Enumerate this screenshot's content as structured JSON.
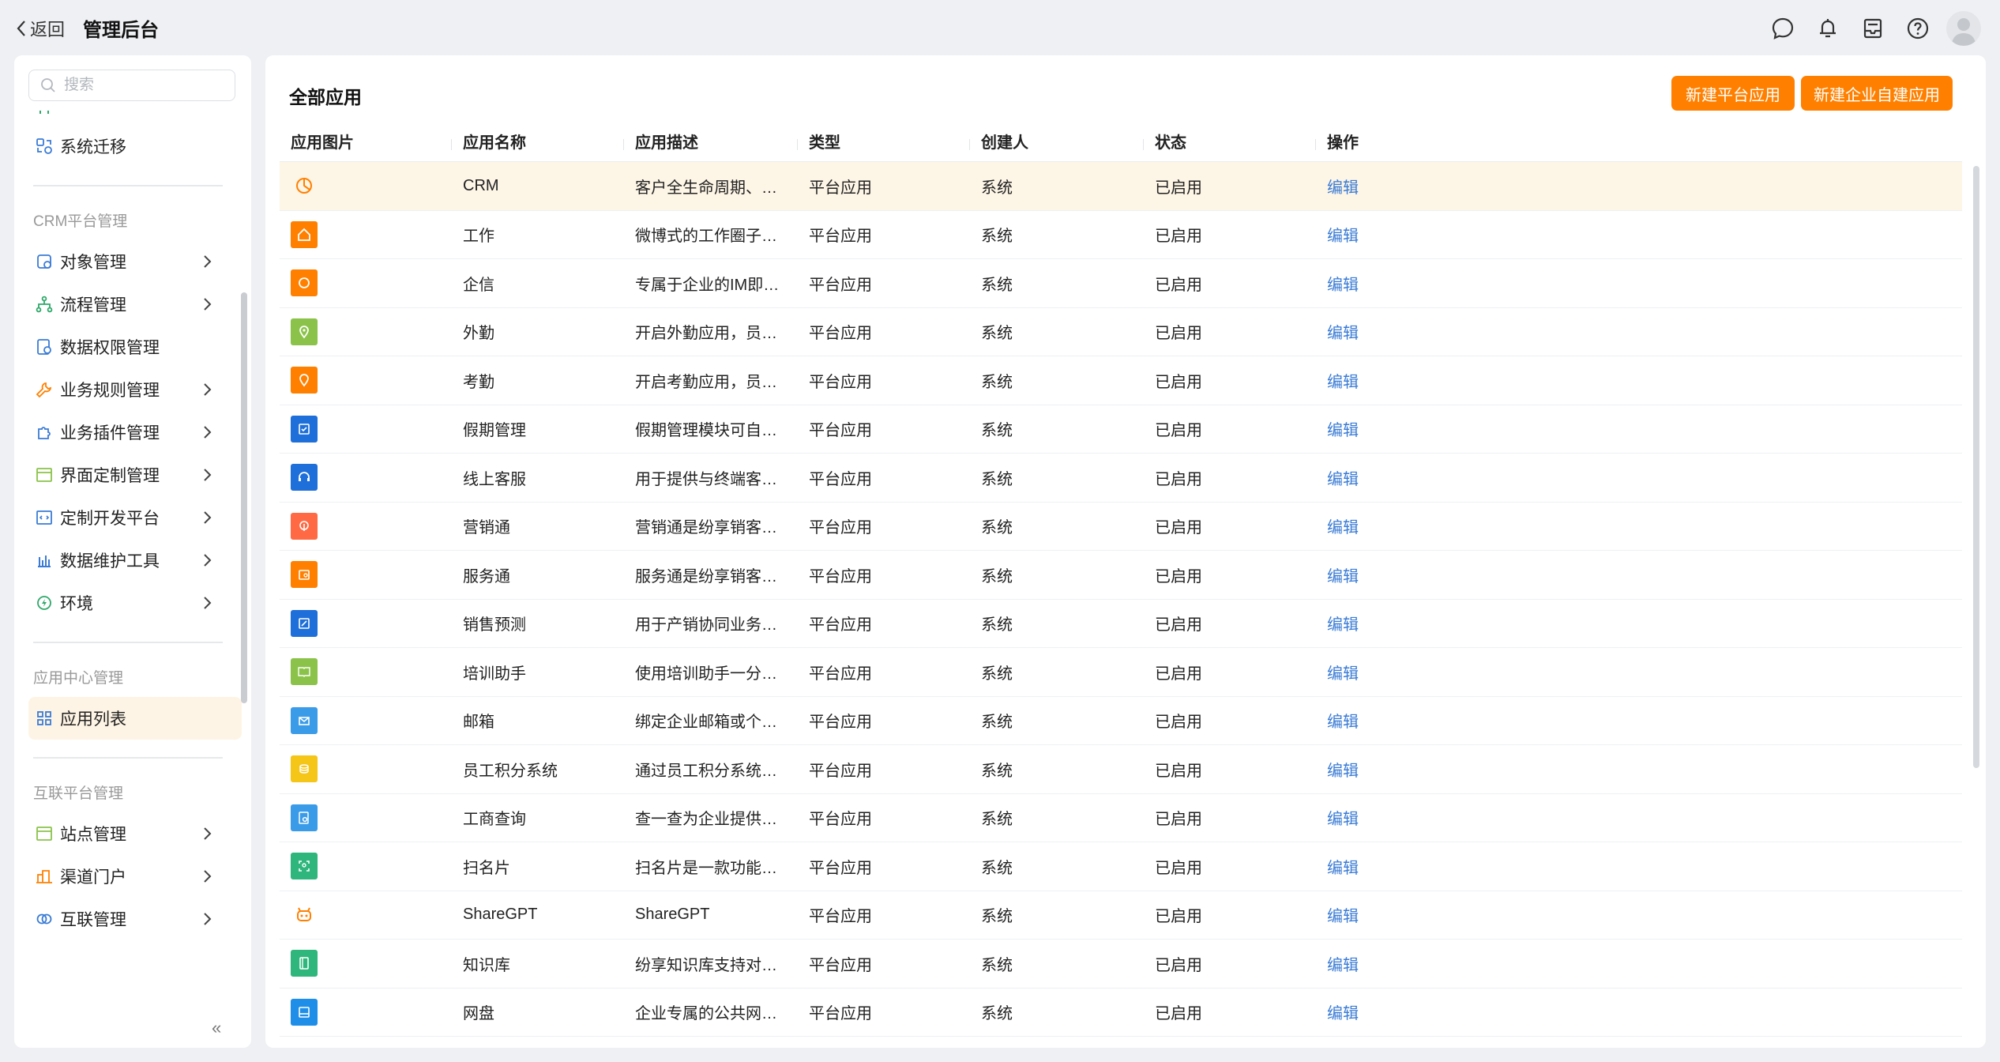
{
  "header": {
    "back_label": "返回",
    "title": "管理后台",
    "icons": [
      "chat-icon",
      "bell-icon",
      "inbox-icon",
      "help-icon",
      "avatar"
    ]
  },
  "sidebar": {
    "search_placeholder": "搜索",
    "partial_item": "",
    "migrate_label": "系统迁移",
    "groups": [
      {
        "title": "CRM平台管理",
        "items": [
          {
            "label": "对象管理",
            "icon": "object-icon",
            "color": "#3a7bd5",
            "chevron": true
          },
          {
            "label": "流程管理",
            "icon": "flow-icon",
            "color": "#2fa86a",
            "chevron": true
          },
          {
            "label": "数据权限管理",
            "icon": "data-permission-icon",
            "color": "#3a7bd5",
            "chevron": false
          },
          {
            "label": "业务规则管理",
            "icon": "wrench-icon",
            "color": "#ff8000",
            "chevron": true
          },
          {
            "label": "业务插件管理",
            "icon": "puzzle-icon",
            "color": "#3a7bd5",
            "chevron": true
          },
          {
            "label": "界面定制管理",
            "icon": "layout-icon",
            "color": "#8bc34a",
            "chevron": true
          },
          {
            "label": "定制开发平台",
            "icon": "code-icon",
            "color": "#3a7bd5",
            "chevron": true
          },
          {
            "label": "数据维护工具",
            "icon": "bar-chart-icon",
            "color": "#3a7bd5",
            "chevron": true
          },
          {
            "label": "环境",
            "icon": "environment-icon",
            "color": "#2fa86a",
            "chevron": true
          }
        ]
      },
      {
        "title": "应用中心管理",
        "items": [
          {
            "label": "应用列表",
            "icon": "grid-icon",
            "color": "#3a7bd5",
            "chevron": false,
            "active": true
          }
        ]
      },
      {
        "title": "互联平台管理",
        "items": [
          {
            "label": "站点管理",
            "icon": "site-icon",
            "color": "#8bc34a",
            "chevron": true
          },
          {
            "label": "渠道门户",
            "icon": "building-icon",
            "color": "#ff8000",
            "chevron": true
          },
          {
            "label": "互联管理",
            "icon": "link-icon",
            "color": "#3a7bd5",
            "chevron": true
          }
        ]
      }
    ],
    "collapse": "«"
  },
  "main": {
    "title": "全部应用",
    "buttons": {
      "new_platform": "新建平台应用",
      "new_enterprise": "新建企业自建应用"
    },
    "columns": [
      "应用图片",
      "应用名称",
      "应用描述",
      "类型",
      "创建人",
      "状态",
      "操作"
    ],
    "rows": [
      {
        "name": "CRM",
        "desc": "客户全生命周期、…",
        "type": "平台应用",
        "creator": "系统",
        "status": "已启用",
        "action": "编辑",
        "icon": "pie-icon",
        "color": "#ff8000",
        "outline": true
      },
      {
        "name": "工作",
        "desc": "微博式的工作圈子…",
        "type": "平台应用",
        "creator": "系统",
        "status": "已启用",
        "action": "编辑",
        "icon": "home-icon",
        "color": "#ff8000"
      },
      {
        "name": "企信",
        "desc": "专属于企业的IM即…",
        "type": "平台应用",
        "creator": "系统",
        "status": "已启用",
        "action": "编辑",
        "icon": "message-icon",
        "color": "#ff8000"
      },
      {
        "name": "外勤",
        "desc": "开启外勤应用，员…",
        "type": "平台应用",
        "creator": "系统",
        "status": "已启用",
        "action": "编辑",
        "icon": "location-icon",
        "color": "#8bc34a"
      },
      {
        "name": "考勤",
        "desc": "开启考勤应用，员…",
        "type": "平台应用",
        "creator": "系统",
        "status": "已启用",
        "action": "编辑",
        "icon": "checkin-icon",
        "color": "#ff8000"
      },
      {
        "name": "假期管理",
        "desc": "假期管理模块可自…",
        "type": "平台应用",
        "creator": "系统",
        "status": "已启用",
        "action": "编辑",
        "icon": "calendar-check-icon",
        "color": "#1e6fd9"
      },
      {
        "name": "线上客服",
        "desc": "用于提供与终端客…",
        "type": "平台应用",
        "creator": "系统",
        "status": "已启用",
        "action": "编辑",
        "icon": "headset-icon",
        "color": "#1e6fd9"
      },
      {
        "name": "营销通",
        "desc": "营销通是纷享销客…",
        "type": "平台应用",
        "creator": "系统",
        "status": "已启用",
        "action": "编辑",
        "icon": "marketing-icon",
        "color": "#ff6a45"
      },
      {
        "name": "服务通",
        "desc": "服务通是纷享销客…",
        "type": "平台应用",
        "creator": "系统",
        "status": "已启用",
        "action": "编辑",
        "icon": "service-icon",
        "color": "#ff8000"
      },
      {
        "name": "销售预测",
        "desc": "用于产销协同业务…",
        "type": "平台应用",
        "creator": "系统",
        "status": "已启用",
        "action": "编辑",
        "icon": "forecast-icon",
        "color": "#1e6fd9"
      },
      {
        "name": "培训助手",
        "desc": "使用培训助手一分…",
        "type": "平台应用",
        "creator": "系统",
        "status": "已启用",
        "action": "编辑",
        "icon": "book-icon",
        "color": "#8bc34a"
      },
      {
        "name": "邮箱",
        "desc": "绑定企业邮箱或个…",
        "type": "平台应用",
        "creator": "系统",
        "status": "已启用",
        "action": "编辑",
        "icon": "mail-icon",
        "color": "#3a9be8"
      },
      {
        "name": "员工积分系统",
        "desc": "通过员工积分系统…",
        "type": "平台应用",
        "creator": "系统",
        "status": "已启用",
        "action": "编辑",
        "icon": "coins-icon",
        "color": "#f5c518"
      },
      {
        "name": "工商查询",
        "desc": "查一查为企业提供…",
        "type": "平台应用",
        "creator": "系统",
        "status": "已启用",
        "action": "编辑",
        "icon": "query-icon",
        "color": "#3a9be8"
      },
      {
        "name": "扫名片",
        "desc": "扫名片是一款功能…",
        "type": "平台应用",
        "creator": "系统",
        "status": "已启用",
        "action": "编辑",
        "icon": "scan-icon",
        "color": "#2fb67c"
      },
      {
        "name": "ShareGPT",
        "desc": "ShareGPT",
        "type": "平台应用",
        "creator": "系统",
        "status": "已启用",
        "action": "编辑",
        "icon": "robot-icon",
        "color": "#ff8000",
        "outline": true
      },
      {
        "name": "知识库",
        "desc": "纷享知识库支持对…",
        "type": "平台应用",
        "creator": "系统",
        "status": "已启用",
        "action": "编辑",
        "icon": "knowledge-icon",
        "color": "#2fb67c"
      },
      {
        "name": "网盘",
        "desc": "企业专属的公共网…",
        "type": "平台应用",
        "creator": "系统",
        "status": "已启用",
        "action": "编辑",
        "icon": "disk-icon",
        "color": "#1e8ee8"
      }
    ]
  }
}
